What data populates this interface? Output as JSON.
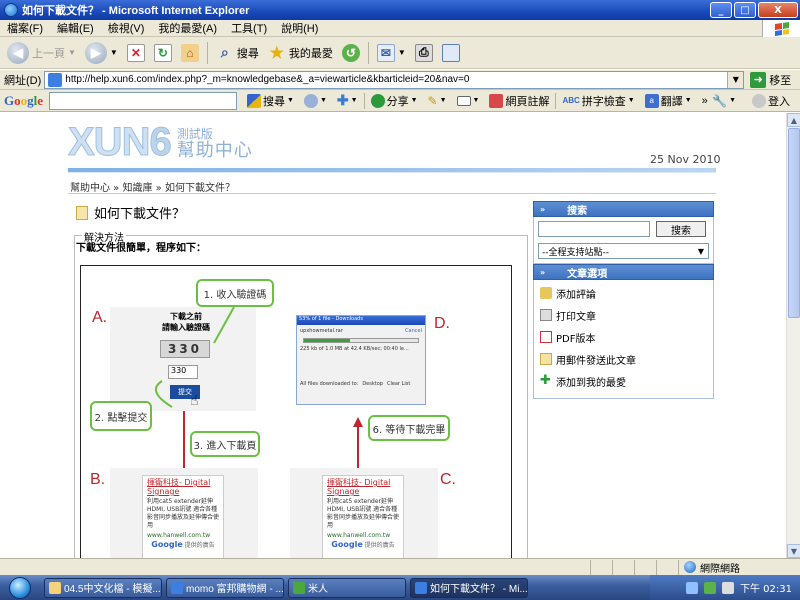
{
  "window": {
    "title": "如何下載文件？ - Microsoft Internet Explorer",
    "min": "_",
    "max": "□",
    "close": "X"
  },
  "menu": [
    "檔案(F)",
    "編輯(E)",
    "檢視(V)",
    "我的最愛(A)",
    "工具(T)",
    "說明(H)"
  ],
  "toolbar": {
    "back_label": "上一頁",
    "search_label": "搜尋",
    "favorites_label": "我的最愛"
  },
  "address": {
    "label": "網址(D)",
    "url": "http://help.xun6.com/index.php?_m=knowledgebase&_a=viewarticle&kbarticleid=20&nav=0",
    "go_label": "移至"
  },
  "google_toolbar": {
    "logo": "Google",
    "search_label": "搜尋",
    "share_label": "分享",
    "annotate_label": "網頁註解",
    "spell_label": "拼字檢查",
    "translate_label": "翻譯",
    "more": "»",
    "login_label": "登入"
  },
  "site": {
    "logo_main": "XUN",
    "logo_num": "6",
    "logo_sub": "測試版",
    "logo_help": "幫助中心",
    "date": "25 Nov 2010",
    "breadcrumb": "幫助中心 » 知識庫 » 如何下載文件？",
    "article_title": "如何下載文件？",
    "legend": "解決方法",
    "intro": "下載文件很簡單，程序如下："
  },
  "illustration": {
    "labels": {
      "a": "A.",
      "b": "B.",
      "c": "C.",
      "d": "D."
    },
    "step1": "1. 收入驗證碼",
    "step2": "2. 點擊提交",
    "step3": "3. 進入下載頁",
    "step6": "6. 等待下載完畢",
    "captcha_heading": "下載之前",
    "captcha_prompt": "請輸入驗證碼",
    "captcha_code": "330",
    "captcha_input": "330",
    "submit": "提交",
    "download_title": "53% of 1 file - Downloads",
    "download_file": "upxhowmetal.rar",
    "download_status": "225 kb of 1.0 MB at 42.4 KB/sec; 00:40 le...",
    "download_cancel": "Cancel",
    "download_foot": "All files downloaded to:",
    "download_folder": "Desktop",
    "download_clear": "Clear List",
    "ad_title": "揮衛科技- Digital Signage",
    "ad_desc": "利用cat5 extender延伸HDMI, USB訊號 適合各種影音同步播放及延伸傳合使用",
    "ad_url": "www.hanwell.com.tw",
    "ad_foot_prefix": "Google",
    "ad_foot_suffix": "提供的廣告"
  },
  "sidebar": {
    "search_header": "搜索",
    "search_button": "搜索",
    "select_value": "--全程支持站點--",
    "options_header": "文章選項",
    "options": [
      "添加評論",
      "打印文章",
      "PDF版本",
      "用郵件發送此文章",
      "添加到我的最愛"
    ]
  },
  "status": {
    "zone": "網際網路"
  },
  "taskbar": {
    "tasks": [
      "04.5中文化檔 - 模擬...",
      "momo 富邦購物網 - ...",
      "米人",
      "如何下載文件？ - Mi..."
    ],
    "clock": "下午 02:31"
  },
  "colors": {
    "accent": "#3f73c1",
    "callout": "#6cbf45",
    "label_red": "#c0262b"
  }
}
